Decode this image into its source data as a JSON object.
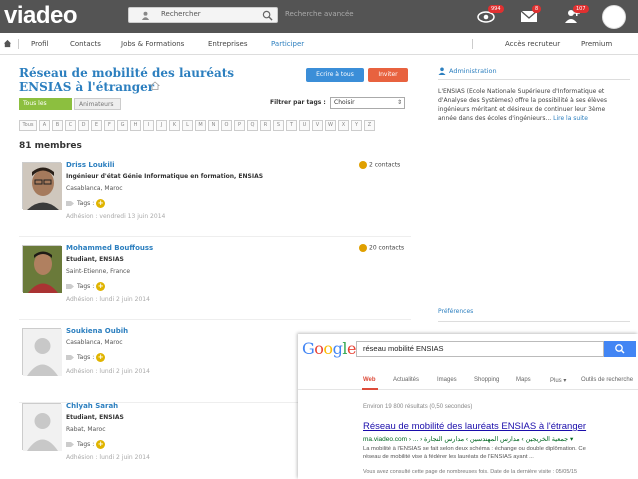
{
  "header": {
    "logo": "viadeo",
    "search_placeholder": "Rechercher",
    "advanced_search": "Recherche avancée",
    "badges": {
      "views": "994",
      "messages": "8",
      "contacts": "107"
    }
  },
  "nav": {
    "items": [
      "Profil",
      "Contacts",
      "Jobs & Formations",
      "Entreprises",
      "Participer"
    ],
    "active": "Participer",
    "right": [
      "Accès recruteur",
      "Premium"
    ]
  },
  "group": {
    "title_line1": "Réseau de mobilité des lauréats",
    "title_line2": "ENSIAS à l'étranger",
    "write_all": "Ecrire à tous",
    "invite": "Inviter",
    "tabs": [
      "Tous les membres",
      "Animateurs"
    ],
    "filter_label": "Filtrer par tags :",
    "filter_value": "Choisir",
    "alphabet": [
      "Tous",
      "A",
      "B",
      "C",
      "D",
      "E",
      "F",
      "G",
      "H",
      "I",
      "J",
      "K",
      "L",
      "M",
      "N",
      "O",
      "P",
      "Q",
      "R",
      "S",
      "T",
      "U",
      "V",
      "W",
      "X",
      "Y",
      "Z"
    ],
    "member_count": "81 membres"
  },
  "members": [
    {
      "name": "Driss Loukili",
      "title": "Ingénieur d'état Génie Informatique en formation, ENSIAS",
      "location": "Casablanca, Maroc",
      "tags": "Tags :",
      "date": "Adhésion : vendredi 13 juin 2014",
      "contacts": "2 contacts"
    },
    {
      "name": "Mohammed Bouffouss",
      "title": "Etudiant, ENSIAS",
      "location": "Saint-Etienne, France",
      "tags": "Tags :",
      "date": "Adhésion : lundi 2 juin 2014",
      "contacts": "20 contacts"
    },
    {
      "name": "Soukiena Oubih",
      "title": "",
      "location": "Casablanca, Maroc",
      "tags": "Tags :",
      "date": "Adhésion : lundi 2 juin 2014",
      "contacts": ""
    },
    {
      "name": "Chlyah Sarah",
      "title": "Etudiant, ENSIAS",
      "location": "Rabat, Maroc",
      "tags": "Tags :",
      "date": "Adhésion : lundi 2 juin 2014",
      "contacts": ""
    }
  ],
  "sidebar": {
    "admin_link": "Administration",
    "description": "L'ENSIAS (Ecole Nationale Supérieure d'Informatique et d'Analyse des Systèmes) offre la possibilité à ses élèves ingénieurs méritant et désireux de continuer leur 3ème année dans des écoles d'ingénieurs...",
    "read_more": "Lire la suite",
    "preferences": "Préférences"
  },
  "google": {
    "query": "réseau mobilité ENSIAS",
    "tabs": [
      "Web",
      "Actualités",
      "Images",
      "Shopping",
      "Maps",
      "Plus ▾",
      "Outils de recherche"
    ],
    "stats": "Environ 19 800 résultats (0,50 secondes)",
    "result_title": "Réseau de mobilité des lauréats ENSIAS à l'étranger",
    "result_url": "ma.viadeo.com › ... › جمعية الخريجين › مدارس المهندسين › مدارس النجارة ▾",
    "snippet_a": "La mobilité à l'ENSIAS se fait selon deux schéma : échange ou double diplômation. Ce",
    "snippet_b": "réseau de mobilité vise à fédérer les lauréats de l'ENSIAS ayant ...",
    "visited": "Vous avez consulté cette page de nombreuses fois. Date de la dernière visite : 05/05/15"
  },
  "colors": {
    "topbar": "#545454",
    "link": "#2c7fbf",
    "btn_blue": "#3b8ed8",
    "btn_red": "#e8623f",
    "tab_active": "#8cbf3f",
    "tag_plus": "#e0b400"
  }
}
